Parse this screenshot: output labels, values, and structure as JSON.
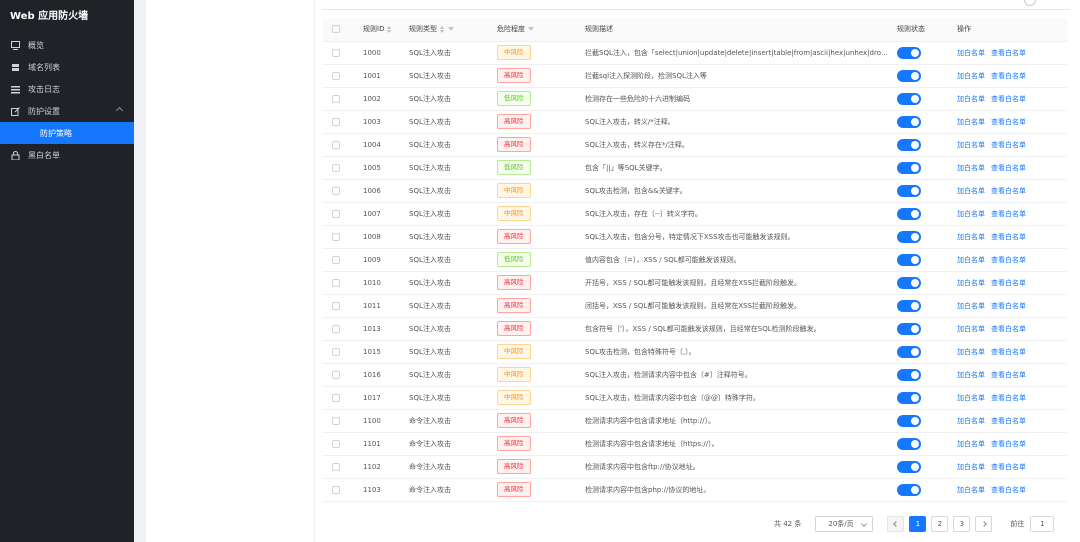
{
  "sidebar": {
    "title": "Web 应用防火墙",
    "items": [
      {
        "label": "概览",
        "icon": "monitor-icon"
      },
      {
        "label": "域名列表",
        "icon": "server-icon"
      },
      {
        "label": "攻击日志",
        "icon": "list-icon"
      },
      {
        "label": "防护设置",
        "icon": "edit-icon"
      },
      {
        "label": "防护策略",
        "icon": ""
      },
      {
        "label": "黑白名单",
        "icon": "lock-icon"
      }
    ]
  },
  "table": {
    "headers": {
      "id": "规则ID",
      "type": "规则类型",
      "level": "危险程度",
      "desc": "规则描述",
      "status": "规则状态",
      "op": "操作"
    },
    "actions": {
      "add_white": "加白名单",
      "view_white": "查看白名单"
    },
    "rows": [
      {
        "id": "1000",
        "type": "SQL注入攻击",
        "level": "中风险",
        "levelClass": "lv-mid",
        "desc": "拦截SQL注入，包含「select|union|update|delete|insert|table|from|ascii|hex|unhex|drop」关…"
      },
      {
        "id": "1001",
        "type": "SQL注入攻击",
        "level": "高风险",
        "levelClass": "lv-high",
        "desc": "拦截sql注入探测阶段，检测SQL注入等"
      },
      {
        "id": "1002",
        "type": "SQL注入攻击",
        "level": "低风险",
        "levelClass": "lv-low",
        "desc": "检测存在一些危险的十六进制编码"
      },
      {
        "id": "1003",
        "type": "SQL注入攻击",
        "level": "高风险",
        "levelClass": "lv-high",
        "desc": "SQL注入攻击，转义/*注释。"
      },
      {
        "id": "1004",
        "type": "SQL注入攻击",
        "level": "高风险",
        "levelClass": "lv-high",
        "desc": "SQL注入攻击，转义存在*/注释。"
      },
      {
        "id": "1005",
        "type": "SQL注入攻击",
        "level": "低风险",
        "levelClass": "lv-low",
        "desc": "包含「||」等SQL关键字。"
      },
      {
        "id": "1006",
        "type": "SQL注入攻击",
        "level": "中风险",
        "levelClass": "lv-mid",
        "desc": "SQL攻击检测，包含&&关键字。"
      },
      {
        "id": "1007",
        "type": "SQL注入攻击",
        "level": "中风险",
        "levelClass": "lv-mid",
        "desc": "SQL注入攻击，存在〔--〕转义字符。"
      },
      {
        "id": "1008",
        "type": "SQL注入攻击",
        "level": "高风险",
        "levelClass": "lv-high",
        "desc": "SQL注入攻击，包含分号，特定情况下XSS攻击也可能触发该规则。"
      },
      {
        "id": "1009",
        "type": "SQL注入攻击",
        "level": "低风险",
        "levelClass": "lv-low",
        "desc": "值内容包含〔=〕，XSS / SQL都可能触发该规则。"
      },
      {
        "id": "1010",
        "type": "SQL注入攻击",
        "level": "高风险",
        "levelClass": "lv-high",
        "desc": "开括号，XSS / SQL都可能触发该规则，且经常在XSS拦截阶段触发。"
      },
      {
        "id": "1011",
        "type": "SQL注入攻击",
        "level": "高风险",
        "levelClass": "lv-high",
        "desc": "闭括号，XSS / SQL都可能触发该规则，且经常在XSS拦截阶段触发。"
      },
      {
        "id": "1013",
        "type": "SQL注入攻击",
        "level": "高风险",
        "levelClass": "lv-high",
        "desc": "包含符号〔'〕，XSS / SQL都可能触发该规则，且经常在SQL检测阶段触发。"
      },
      {
        "id": "1015",
        "type": "SQL注入攻击",
        "level": "中风险",
        "levelClass": "lv-mid",
        "desc": "SQL攻击检测，包含特殊符号〔,〕。"
      },
      {
        "id": "1016",
        "type": "SQL注入攻击",
        "level": "中风险",
        "levelClass": "lv-mid",
        "desc": "SQL注入攻击，检测请求内容中包含〔#〕注释符号。"
      },
      {
        "id": "1017",
        "type": "SQL注入攻击",
        "level": "中风险",
        "levelClass": "lv-mid",
        "desc": "SQL注入攻击，检测请求内容中包含〔@@〕特殊字符。"
      },
      {
        "id": "1100",
        "type": "命令注入攻击",
        "level": "高风险",
        "levelClass": "lv-high",
        "desc": "检测请求内容中包含请求地址〔http://〕。"
      },
      {
        "id": "1101",
        "type": "命令注入攻击",
        "level": "高风险",
        "levelClass": "lv-high",
        "desc": "检测请求内容中包含请求地址〔https://〕。"
      },
      {
        "id": "1102",
        "type": "命令注入攻击",
        "level": "高风险",
        "levelClass": "lv-high",
        "desc": "检测请求内容中包含ftp://协议地址。"
      },
      {
        "id": "1103",
        "type": "命令注入攻击",
        "level": "高风险",
        "levelClass": "lv-high",
        "desc": "检测请求内容中包含php://协议的地址。"
      }
    ]
  },
  "pagination": {
    "total": "共 42 条",
    "page_size": "20条/页",
    "pages": [
      "1",
      "2",
      "3"
    ],
    "current": "1",
    "jump_label": "前往",
    "jump_value": "1"
  }
}
